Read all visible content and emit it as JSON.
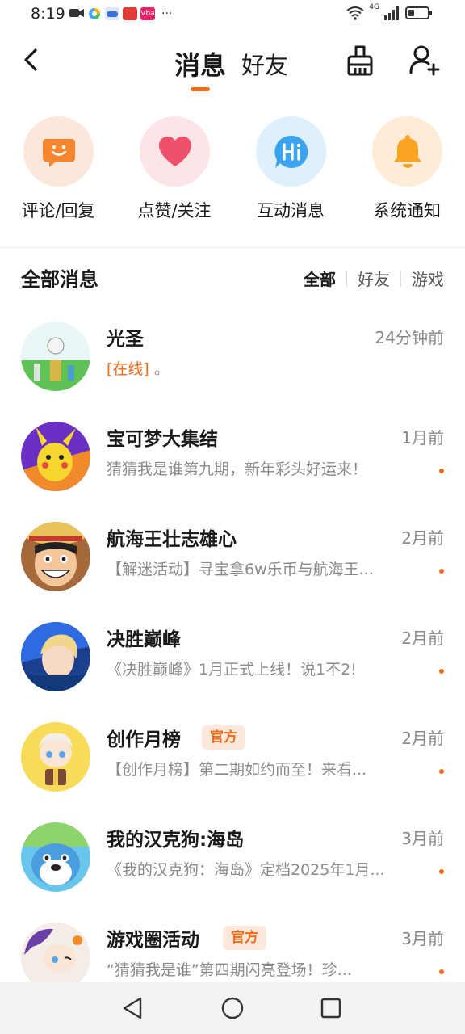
{
  "status_bar": {
    "time": "8:19",
    "app_icons": [
      {
        "name": "camera-app-icon",
        "color": "#333333",
        "label": ""
      },
      {
        "name": "colorful-app-icon",
        "color": "#4aa3ff",
        "label": ""
      },
      {
        "name": "game-app-icon",
        "color": "#3a6fd8",
        "label": ""
      },
      {
        "name": "red-app-icon",
        "color": "#e53935",
        "label": ""
      },
      {
        "name": "pink-app-icon",
        "color": "#e91e63",
        "label": "Vba"
      }
    ],
    "more": "···",
    "network": "4G"
  },
  "header": {
    "tab_messages": "消息",
    "tab_friends": "好友",
    "accent_color": "#f06a1a"
  },
  "categories": [
    {
      "label": "评论/回复",
      "icon": "comment-icon",
      "bg": "#fde7da",
      "fg": "#f5862e"
    },
    {
      "label": "点赞/关注",
      "icon": "heart-icon",
      "bg": "#fde4e6",
      "fg": "#f0516a"
    },
    {
      "label": "互动消息",
      "icon": "hi-icon",
      "bg": "#dff0fd",
      "fg": "#3ba4f0"
    },
    {
      "label": "系统通知",
      "icon": "bell-icon",
      "bg": "#feecd6",
      "fg": "#f9a423"
    }
  ],
  "section": {
    "title": "全部消息",
    "filters": [
      "全部",
      "好友",
      "游戏"
    ],
    "active_filter": "全部"
  },
  "messages": [
    {
      "name": "光圣",
      "time": "24分钟前",
      "preview_online": "[在线]",
      "preview": " 。",
      "badge": "",
      "unread": false
    },
    {
      "name": "宝可梦大集结",
      "time": "1月前",
      "preview_online": "",
      "preview": "猜猜我是谁第九期，新年彩头好运来！",
      "badge": "",
      "unread": true
    },
    {
      "name": "航海王壮志雄心",
      "time": "2月前",
      "preview_online": "",
      "preview": "【解迷活动】寻宝拿6w乐币与航海王...",
      "badge": "",
      "unread": true
    },
    {
      "name": "决胜巅峰",
      "time": "2月前",
      "preview_online": "",
      "preview": "《决胜巅峰》1月正式上线！说1不2!",
      "badge": "",
      "unread": true
    },
    {
      "name": "创作月榜",
      "time": "2月前",
      "preview_online": "",
      "preview": "【创作月榜】第二期如约而至！来看...",
      "badge": "官方",
      "unread": true
    },
    {
      "name": "我的汉克狗:海岛",
      "time": "3月前",
      "preview_online": "",
      "preview": "《我的汉克狗：海岛》定档2025年1月...",
      "badge": "",
      "unread": true
    },
    {
      "name": "游戏圈活动",
      "time": "3月前",
      "preview_online": "",
      "preview": "“猜猜我是谁”第四期闪亮登场！珍...",
      "badge": "官方",
      "unread": true
    }
  ]
}
